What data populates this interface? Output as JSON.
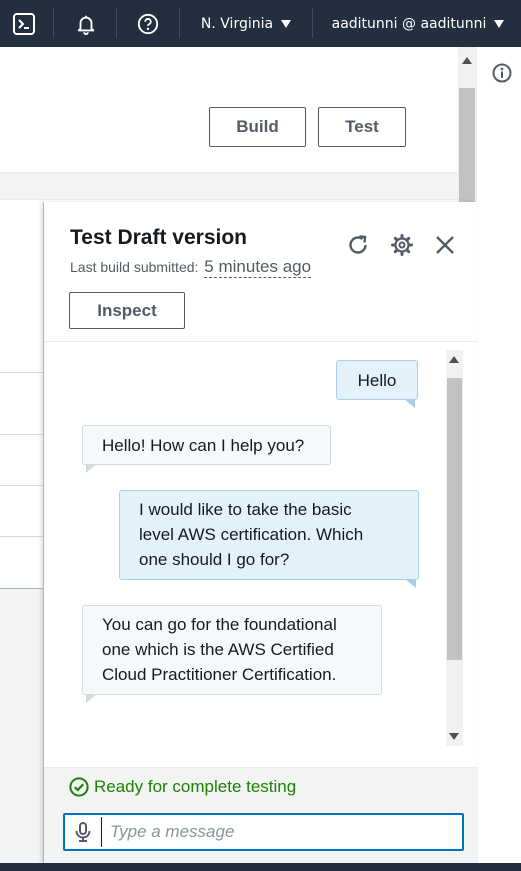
{
  "topbar": {
    "region": "N. Virginia",
    "account": "aaditunni @ aaditunni",
    "icons": [
      "cloudshell-icon",
      "bell-icon",
      "help-icon"
    ]
  },
  "toolbar": {
    "build_label": "Build",
    "test_label": "Test"
  },
  "test_panel": {
    "title": "Test Draft version",
    "subtitle_prefix": "Last build submitted:",
    "subtitle_time": "5 minutes ago",
    "inspect_label": "Inspect",
    "icons": [
      "refresh-icon",
      "settings-icon",
      "close-icon"
    ],
    "messages": [
      {
        "role": "user",
        "lines": [
          "Hello"
        ]
      },
      {
        "role": "bot",
        "lines": [
          "Hello! How can I help you?"
        ]
      },
      {
        "role": "user",
        "lines": [
          "I would like to take the basic",
          "level AWS certification. Which",
          "one should I go for?"
        ]
      },
      {
        "role": "bot",
        "lines": [
          "You can go for the foundational",
          "one which is the AWS Certified",
          "Cloud Practitioner Certification."
        ]
      }
    ],
    "status": "Ready for complete testing",
    "input": {
      "placeholder": "Type a message",
      "value": ""
    }
  },
  "colors": {
    "nav_bg": "#232f3e",
    "status_green": "#1d8102",
    "focus_blue": "#0073bb",
    "user_bubble": "#e3f1fb",
    "bot_bubble": "#f5f9fc"
  }
}
